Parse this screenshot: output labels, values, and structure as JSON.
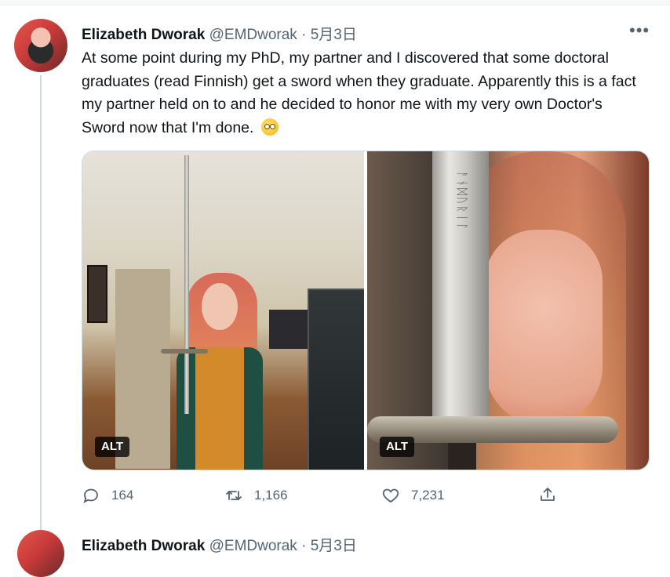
{
  "tweet": {
    "author_name": "Elizabeth Dworak",
    "handle": "@EMDworak",
    "separator": "·",
    "date": "5月3日",
    "more_label": "•••",
    "text": "At some point during my PhD, my partner and I discovered that some doctoral graduates (read Finnish) get a sword when they graduate. Apparently this is a fact my partner held on to and he decided to honor me with my very own Doctor's Sword now that I'm done.",
    "emoji": "rolling-eyes-emoji",
    "media": [
      {
        "alt_label": "ALT"
      },
      {
        "alt_label": "ALT",
        "engraving": "ᚨᚾᛞᚢᚱᛁᛚ"
      }
    ],
    "actions": {
      "reply_count": "164",
      "retweet_count": "1,166",
      "like_count": "7,231"
    }
  },
  "next_tweet": {
    "author_name": "Elizabeth Dworak",
    "handle": "@EMDworak",
    "separator": "·",
    "date": "5月3日"
  },
  "colors": {
    "text": "#0f1419",
    "secondary": "#536471",
    "thread_line": "#cfd9de"
  }
}
